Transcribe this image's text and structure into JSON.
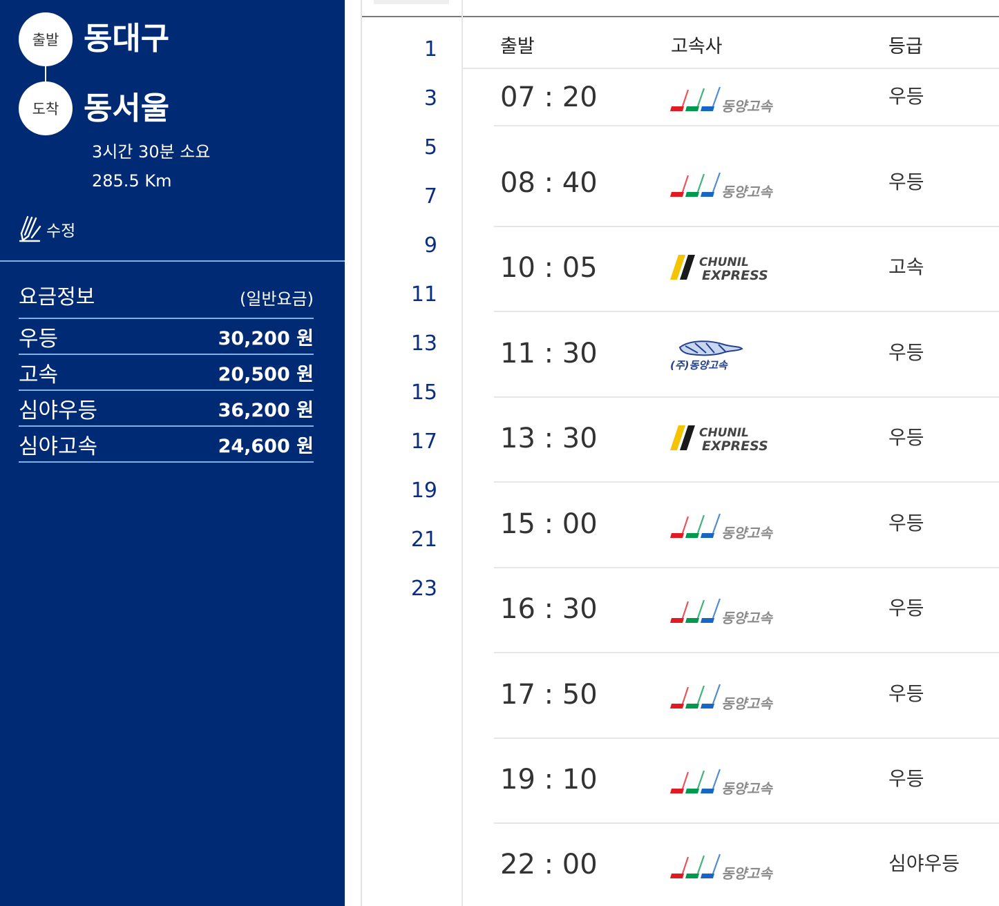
{
  "route": {
    "departure_tag": "출발",
    "departure_name": "동대구",
    "arrival_tag": "도착",
    "arrival_name": "동서울",
    "duration": "3시간 30분 소요",
    "distance": "285.5 Km",
    "edit_label": "수정"
  },
  "fare": {
    "title": "요금정보",
    "note": "(일반요금)",
    "items": [
      {
        "name": "우등",
        "price": "30,200 원"
      },
      {
        "name": "고속",
        "price": "20,500 원"
      },
      {
        "name": "심야우등",
        "price": "36,200 원"
      },
      {
        "name": "심야고속",
        "price": "24,600 원"
      }
    ]
  },
  "hours": [
    "1",
    "3",
    "5",
    "7",
    "9",
    "11",
    "13",
    "15",
    "17",
    "19",
    "21",
    "23"
  ],
  "table": {
    "headers": {
      "departure": "출발",
      "company": "고속사",
      "grade": "등급"
    },
    "rows": [
      {
        "time": "07 : 20",
        "company": "동양고속",
        "grade": "우등"
      },
      {
        "time": "08 : 40",
        "company": "동양고속",
        "grade": "우등"
      },
      {
        "time": "10 : 05",
        "company": "CHUNIL EXPRESS",
        "grade": "고속"
      },
      {
        "time": "11 : 30",
        "company": "(주)동양고속",
        "grade": "우등"
      },
      {
        "time": "13 : 30",
        "company": "CHUNIL EXPRESS",
        "grade": "우등"
      },
      {
        "time": "15 : 00",
        "company": "동양고속",
        "grade": "우등"
      },
      {
        "time": "16 : 30",
        "company": "동양고속",
        "grade": "우등"
      },
      {
        "time": "17 : 50",
        "company": "동양고속",
        "grade": "우등"
      },
      {
        "time": "19 : 10",
        "company": "동양고속",
        "grade": "우등"
      },
      {
        "time": "22 : 00",
        "company": "동양고속",
        "grade": "심야우등"
      }
    ]
  },
  "colors": {
    "panel_bg": "#002a73",
    "panel_line": "#7fb3e8",
    "hour_text": "#0a2f82",
    "logo_red": "#e21a22",
    "logo_green": "#009a4e",
    "logo_blue": "#1766c6",
    "chunil_yellow": "#f4c400",
    "chunil_black": "#1a1a1a"
  }
}
